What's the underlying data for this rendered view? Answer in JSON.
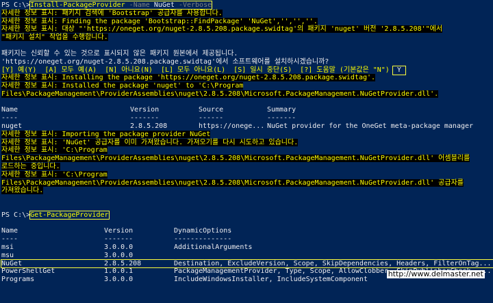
{
  "prompt": "PS C:\\>",
  "cmd1": {
    "cmdlet": "Install-PackageProvider",
    "p1": "-Name",
    "v1": "NuGet",
    "p2": "-Verbose"
  },
  "verbose1": [
    "자세한 정보 표시: 패키지 검색에 'Bootstrap' 공급자를 사용합니다.",
    "자세한 정보 표시: Finding the package 'Bootstrap::FindPackage' 'NuGet','','',''.",
    "자세한 정보 표시: 대상 \"'https://oneget.org/nuget-2.8.5.208.package.swidtag'의 패키지 'nuget' 버전 '2.8.5.208'\"에서",
    "\"패키지 설치\" 작업을 수행합니다."
  ],
  "trust": [
    "패키지는 신뢰할 수 있는 것으로 표시되지 않은 패키지 원본에서 제공됩니다.",
    "'https://oneget.org/nuget-2.8.5.208.package.swidtag'에서 소프트웨어를 설치하시겠습니까?"
  ],
  "choices": "[Y] 예(Y)  [A] 모두 예(A)  [N] 아니요(N)  [L] 모두 아니요(L)  [S] 일시 중단(S)  [?] 도움말 (기본값은 \"N\")",
  "answer": "Y",
  "verbose2": [
    "자세한 정보 표시: Installing the package 'https://oneget.org/nuget-2.8.5.208.package.swidtag'.",
    "자세한 정보 표시: Installed the package 'nuget' to 'C:\\Program",
    "Files\\PackageManagement\\ProviderAssemblies\\nuget\\2.8.5.208\\Microsoft.PackageManagement.NuGetProvider.dll'."
  ],
  "table1": {
    "headers": [
      "Name",
      "Version",
      "Source",
      "Summary"
    ],
    "dashes": [
      "----",
      "-------",
      "------",
      "-------"
    ],
    "row": [
      "nuget",
      "2.8.5.208",
      "https://onege...",
      "NuGet provider for the OneGet meta-package manager"
    ]
  },
  "verbose3": [
    "자세한 정보 표시: Importing the package provider NuGet",
    "자세한 정보 표시: 'NuGet' 공급자를 이미 가져왔습니다. 가져오기를 다시 시도하고 있습니다.",
    "자세한 정보 표시: 'C:\\Program",
    "Files\\PackageManagement\\ProviderAssemblies\\nuget\\2.8.5.208\\Microsoft.PackageManagement.NuGetProvider.dll' 어셈블리를",
    "로드하는 중입니다.",
    "자세한 정보 표시: 'C:\\Program",
    "Files\\PackageManagement\\ProviderAssemblies\\nuget\\2.8.5.208\\Microsoft.PackageManagement.NuGetProvider.dll' 공급자를",
    "가져왔습니다."
  ],
  "cmd2": "Get-PackageProvider",
  "table2": {
    "headers": [
      "Name",
      "Version",
      "DynamicOptions"
    ],
    "dashes": [
      "----",
      "-------",
      "--------------"
    ],
    "rows": [
      [
        "msi",
        "3.0.0.0",
        "AdditionalArguments"
      ],
      [
        "msu",
        "3.0.0.0",
        ""
      ],
      [
        "NuGet",
        "2.8.5.208",
        "Destination, ExcludeVersion, Scope, SkipDependencies, Headers, FilterOnTag..."
      ],
      [
        "PowerShellGet",
        "1.0.0.1",
        "PackageManagementProvider, Type, Scope, AllowClobber, SkipPublisherCheck, ..."
      ],
      [
        "Programs",
        "3.0.0.0",
        "IncludeWindowsInstaller, IncludeSystemComponent"
      ]
    ]
  },
  "watermark": "http://www.delmaster.net",
  "colors": {
    "background": "#012456",
    "text": "#eeedf0",
    "verbose": "#ffff00",
    "highlight_box": "#ffff3c"
  }
}
